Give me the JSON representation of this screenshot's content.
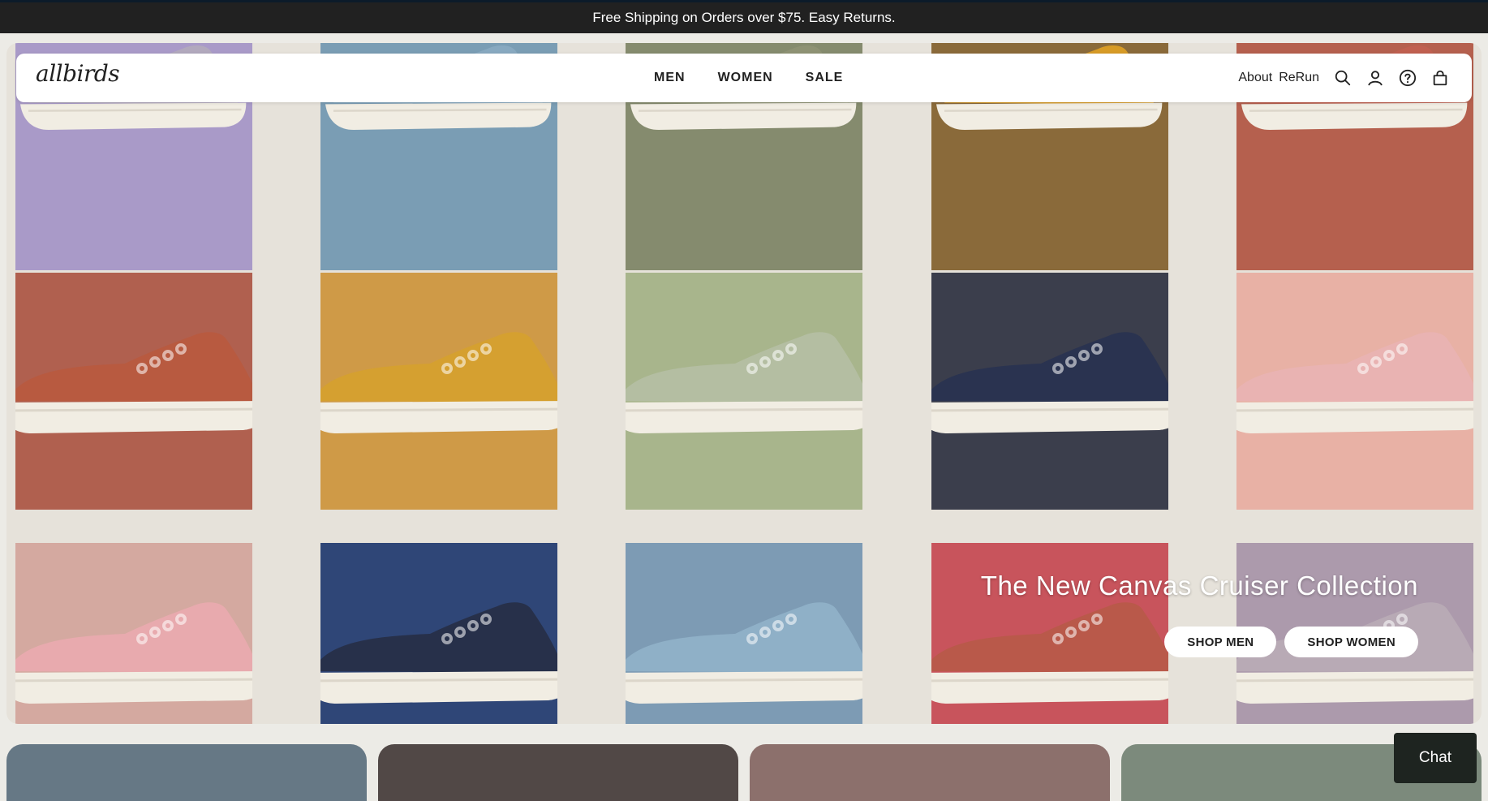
{
  "promo": {
    "text": "Free Shipping on Orders over $75. Easy Returns."
  },
  "nav": {
    "logo": "allbirds",
    "main_links": [
      "MEN",
      "WOMEN",
      "SALE"
    ],
    "right_links": [
      "About",
      "ReRun"
    ],
    "icons": [
      "search-icon",
      "account-icon",
      "help-icon",
      "cart-icon"
    ]
  },
  "hero": {
    "title": "The New Canvas Cruiser Collection",
    "shop_men": "SHOP MEN",
    "shop_women": "SHOP WOMEN",
    "tiles": [
      {
        "bg": "#a99ac8",
        "shoe": "#b2a9bd"
      },
      {
        "bg": "#7a9db4",
        "shoe": "#88a9c0"
      },
      {
        "bg": "#858b6e",
        "shoe": "#8e9274"
      },
      {
        "bg": "#8a6a3a",
        "shoe": "#d79b26"
      },
      {
        "bg": "#b5604e",
        "shoe": "#c06050"
      },
      {
        "bg": "#b0604f",
        "shoe": "#b85a40"
      },
      {
        "bg": "#cf9a47",
        "shoe": "#d5a030"
      },
      {
        "bg": "#a8b58c",
        "shoe": "#b4bea2"
      },
      {
        "bg": "#3b3e4c",
        "shoe": "#2a3350"
      },
      {
        "bg": "#e8b1a5",
        "shoe": "#e9b3b2"
      },
      {
        "bg": "#d4a9a0",
        "shoe": "#e8aaae"
      },
      {
        "bg": "#2f4677",
        "shoe": "#27304a"
      },
      {
        "bg": "#7d9bb4",
        "shoe": "#8fb0c7"
      },
      {
        "bg": "#c8545c",
        "shoe": "#b9594a"
      },
      {
        "bg": "#ac9aac",
        "shoe": "#b8aab5"
      }
    ]
  },
  "chat": {
    "label": "Chat"
  },
  "cards": [
    "#667885",
    "#514846",
    "#8c706c",
    "#7c8a7c"
  ]
}
